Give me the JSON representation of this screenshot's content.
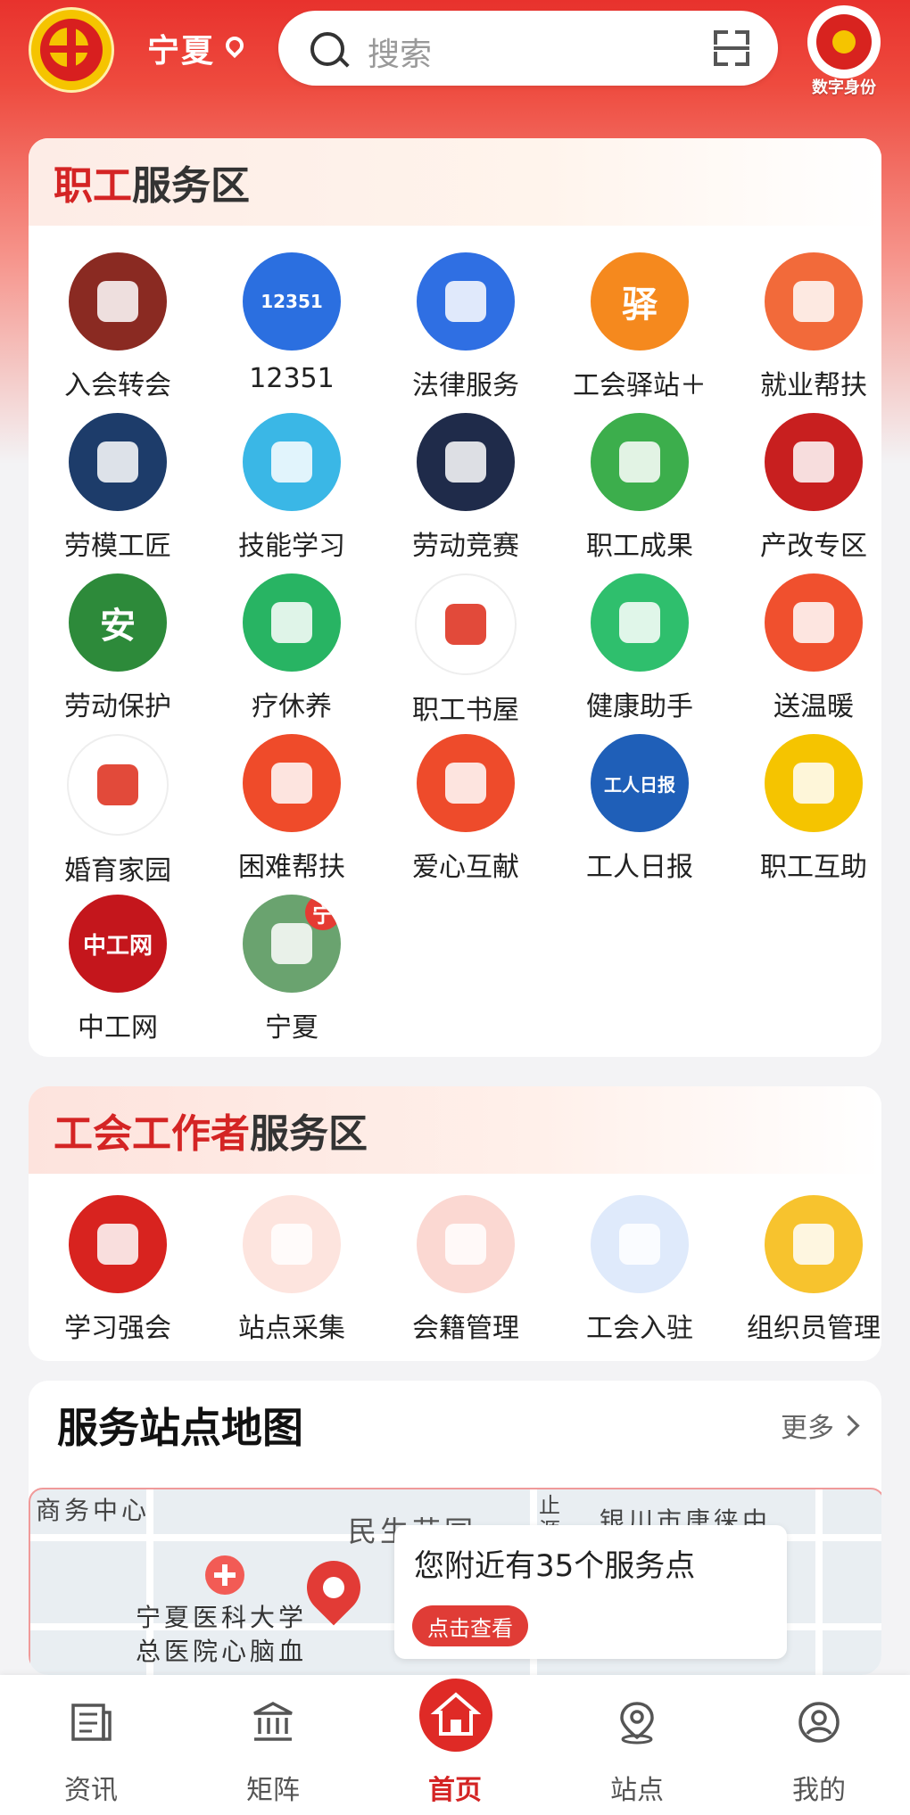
{
  "header": {
    "region": "宁夏",
    "search_placeholder": "搜索",
    "digital_id_label": "数字身份"
  },
  "worker_zone": {
    "title_red": "职工",
    "title_dark": "服务区",
    "items": [
      {
        "label": "入会转会",
        "icon": "membership-book-icon",
        "color": "#8a2a22"
      },
      {
        "label": "12351",
        "icon": "hotline-12351-icon",
        "color": "#2b6fe0",
        "text": "12351"
      },
      {
        "label": "法律服务",
        "icon": "scales-icon",
        "color": "#2f6fe3"
      },
      {
        "label": "工会驿站＋",
        "icon": "station-house-icon",
        "color": "#f5891e",
        "text": "驿"
      },
      {
        "label": "就业帮扶",
        "icon": "job-search-icon",
        "color": "#f26a3a"
      },
      {
        "label": "劳模工匠",
        "icon": "medal-icon",
        "color": "#1d3c6a"
      },
      {
        "label": "技能学习",
        "icon": "worker-laptop-icon",
        "color": "#3ab7e6"
      },
      {
        "label": "劳动竞赛",
        "icon": "competition-icon",
        "color": "#1f2b4a"
      },
      {
        "label": "职工成果",
        "icon": "tree-icon",
        "color": "#3cae4c"
      },
      {
        "label": "产改专区",
        "icon": "industry-icon",
        "color": "#c81f1f"
      },
      {
        "label": "劳动保护",
        "icon": "safety-health-icon",
        "color": "#2d8a3a",
        "text": "安"
      },
      {
        "label": "疗休养",
        "icon": "palm-tree-icon",
        "color": "#28b463"
      },
      {
        "label": "职工书屋",
        "icon": "book-house-icon",
        "color": "#ffffff"
      },
      {
        "label": "健康助手",
        "icon": "nurse-icon",
        "color": "#2fbf6d"
      },
      {
        "label": "送温暖",
        "icon": "heart-hand-icon",
        "color": "#f0502e"
      },
      {
        "label": "婚育家园",
        "icon": "family-heart-icon",
        "color": "#ffffff"
      },
      {
        "label": "困难帮扶",
        "icon": "help-heart-icon",
        "color": "#ef4b2a"
      },
      {
        "label": "爱心互献",
        "icon": "love-hands-icon",
        "color": "#ee4b2b"
      },
      {
        "label": "工人日报",
        "icon": "workers-daily-icon",
        "color": "#1f5fb8",
        "text": "工人日报"
      },
      {
        "label": "职工互助",
        "icon": "union-logo-icon",
        "color": "#f5c400"
      },
      {
        "label": "中工网",
        "icon": "workercn-icon",
        "color": "#c4161c",
        "text": "中工网"
      },
      {
        "label": "宁夏",
        "icon": "ningxia-photo-icon",
        "color": "#6aa36f",
        "badge": "宁"
      }
    ]
  },
  "staff_zone": {
    "title_red": "工会工作者",
    "title_dark": "服务区",
    "items": [
      {
        "label": "学习强会",
        "icon": "union-emblem-icon",
        "color": "#d8231f"
      },
      {
        "label": "站点采集",
        "icon": "map-pin-icon",
        "color": "#fde4de"
      },
      {
        "label": "会籍管理",
        "icon": "member-icon",
        "color": "#fbd8d2"
      },
      {
        "label": "工会入驻",
        "icon": "document-icon",
        "color": "#dfeafb"
      },
      {
        "label": "组织员管理",
        "icon": "id-card-icon",
        "color": "#f7c32e"
      }
    ]
  },
  "map": {
    "title": "服务站点地图",
    "more": "更多",
    "labels": [
      "商务中心",
      "民生花园",
      "银川市唐徕中",
      "宁夏医科大学",
      "总医院心脑血",
      "止",
      "源"
    ],
    "nearby_message": "您附近有35个服务点",
    "view_button": "点击查看"
  },
  "nav": {
    "tabs": [
      {
        "label": "资讯",
        "icon": "news-icon"
      },
      {
        "label": "矩阵",
        "icon": "building-icon"
      },
      {
        "label": "首页",
        "icon": "home-icon",
        "active": true
      },
      {
        "label": "站点",
        "icon": "location-icon"
      },
      {
        "label": "我的",
        "icon": "profile-icon"
      }
    ]
  }
}
